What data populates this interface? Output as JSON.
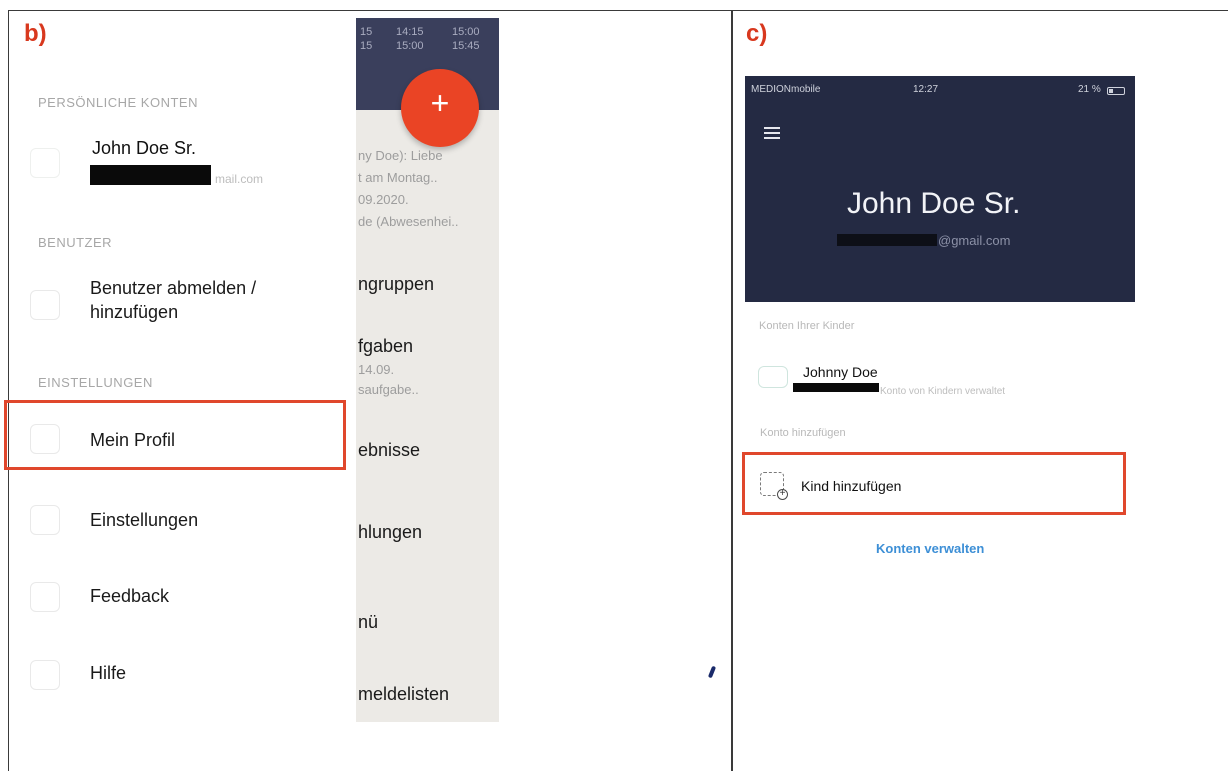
{
  "panels": {
    "b": {
      "tag": "b)"
    },
    "c": {
      "tag": "c)"
    }
  },
  "drawer": {
    "personal_header": "PERSÖNLICHE KONTEN",
    "account_name": "John Doe Sr.",
    "account_email_partial": "mail.com",
    "users_header": "BENUTZER",
    "user_action": "Benutzer abmelden /\nhinzufügen",
    "settings_header": "EINSTELLUNGEN",
    "items": [
      {
        "label": "Mein Profil",
        "icon": "profile-icon"
      },
      {
        "label": "Einstellungen",
        "icon": "settings-icon"
      },
      {
        "label": "Feedback",
        "icon": "feedback-icon"
      },
      {
        "label": "Hilfe",
        "icon": "help-icon"
      }
    ],
    "fab_label": "+",
    "accent_color": "#ea4425"
  },
  "background_view": {
    "timetable": [
      "15",
      "14:15",
      "15:00",
      "15",
      "15:00",
      "15:45"
    ],
    "snippets": [
      "ny Doe): Liebe",
      "t am Montag..",
      "09.2020.",
      "de (Abwesenhei.."
    ],
    "menu": [
      {
        "label": "ngruppen"
      },
      {
        "label": "fgaben",
        "sub": [
          "14.09.",
          "saufgabe.."
        ]
      },
      {
        "label": "ebnisse"
      },
      {
        "label": "hlungen"
      },
      {
        "label": "nü"
      },
      {
        "label": "meldelisten"
      }
    ]
  },
  "phone": {
    "status": {
      "carrier": "MEDIONmobile",
      "time": "12:27",
      "battery": "21 %"
    },
    "menu_icon": "hamburger-icon",
    "profile_name": "John Doe Sr.",
    "profile_email_partial": "@gmail.com",
    "linked_header": "Konten Ihrer Kinder",
    "child_name": "Johnny Doe",
    "child_email_partial": "Konto von Kindern verwaltet",
    "add_header": "Konto hinzufügen",
    "add_child_label": "Kind hinzufügen",
    "manage_label": "Konten verwalten",
    "link_color": "#3d8fd6",
    "header_color": "#242a43"
  }
}
